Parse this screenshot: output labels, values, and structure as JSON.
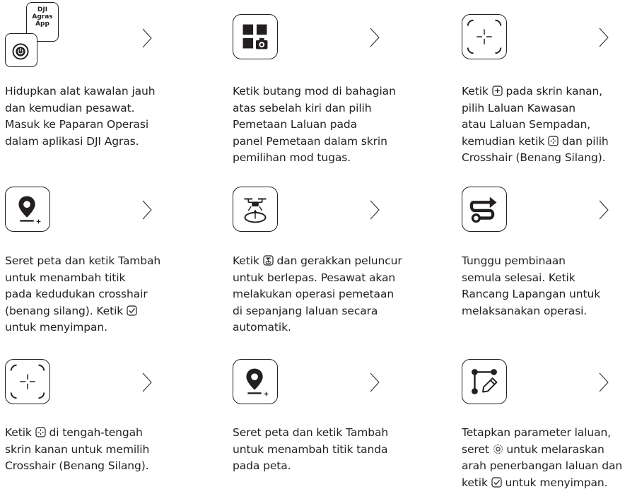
{
  "step1": {
    "app_label": "DJI Agras App",
    "text": "Hidupkan alat kawalan jauh\ndan kemudian pesawat.\nMasuk ke Paparan Operasi\ndalam aplikasi DJI Agras."
  },
  "step2": {
    "text": "Ketik butang mod di bahagian\natas sebelah kiri dan pilih\nPemetaan Laluan pada\npanel Pemetaan dalam skrin\npemilihan mod tugas."
  },
  "step3": {
    "t1": "Ketik ",
    "t2": " pada skrin kanan,\npilih Laluan Kawasan\natau Laluan Sempadan,\nkemudian ketik ",
    "t3": " dan pilih\nCrosshair (Benang Silang)."
  },
  "step4": {
    "t1": "Seret peta dan ketik Tambah\nuntuk menambah titik\npada kedudukan crosshair\n(benang silang). Ketik ",
    "t2": "\nuntuk menyimpan."
  },
  "step5": {
    "t1": "Ketik ",
    "t2": " dan gerakkan peluncur\nuntuk berlepas. Pesawat akan\nmelakukan operasi pemetaan\ndi sepanjang laluan secara\nautomatik."
  },
  "step6": {
    "text": "Tunggu pembinaan\nsemula selesai. Ketik\nRancang Lapangan untuk\nmelaksanakan operasi."
  },
  "step7": {
    "t1": "Ketik ",
    "t2": " di tengah-tengah\nskrin kanan untuk memilih\nCrosshair (Benang Silang)."
  },
  "step8": {
    "text": "Seret peta dan ketik Tambah\nuntuk menambah titik tanda\npada peta."
  },
  "step9": {
    "t1": "Tetapkan parameter laluan,\nseret ",
    "t2": " untuk melaraskan\narah penerbangan laluan dan\nketik ",
    "t3": " untuk menyimpan."
  }
}
